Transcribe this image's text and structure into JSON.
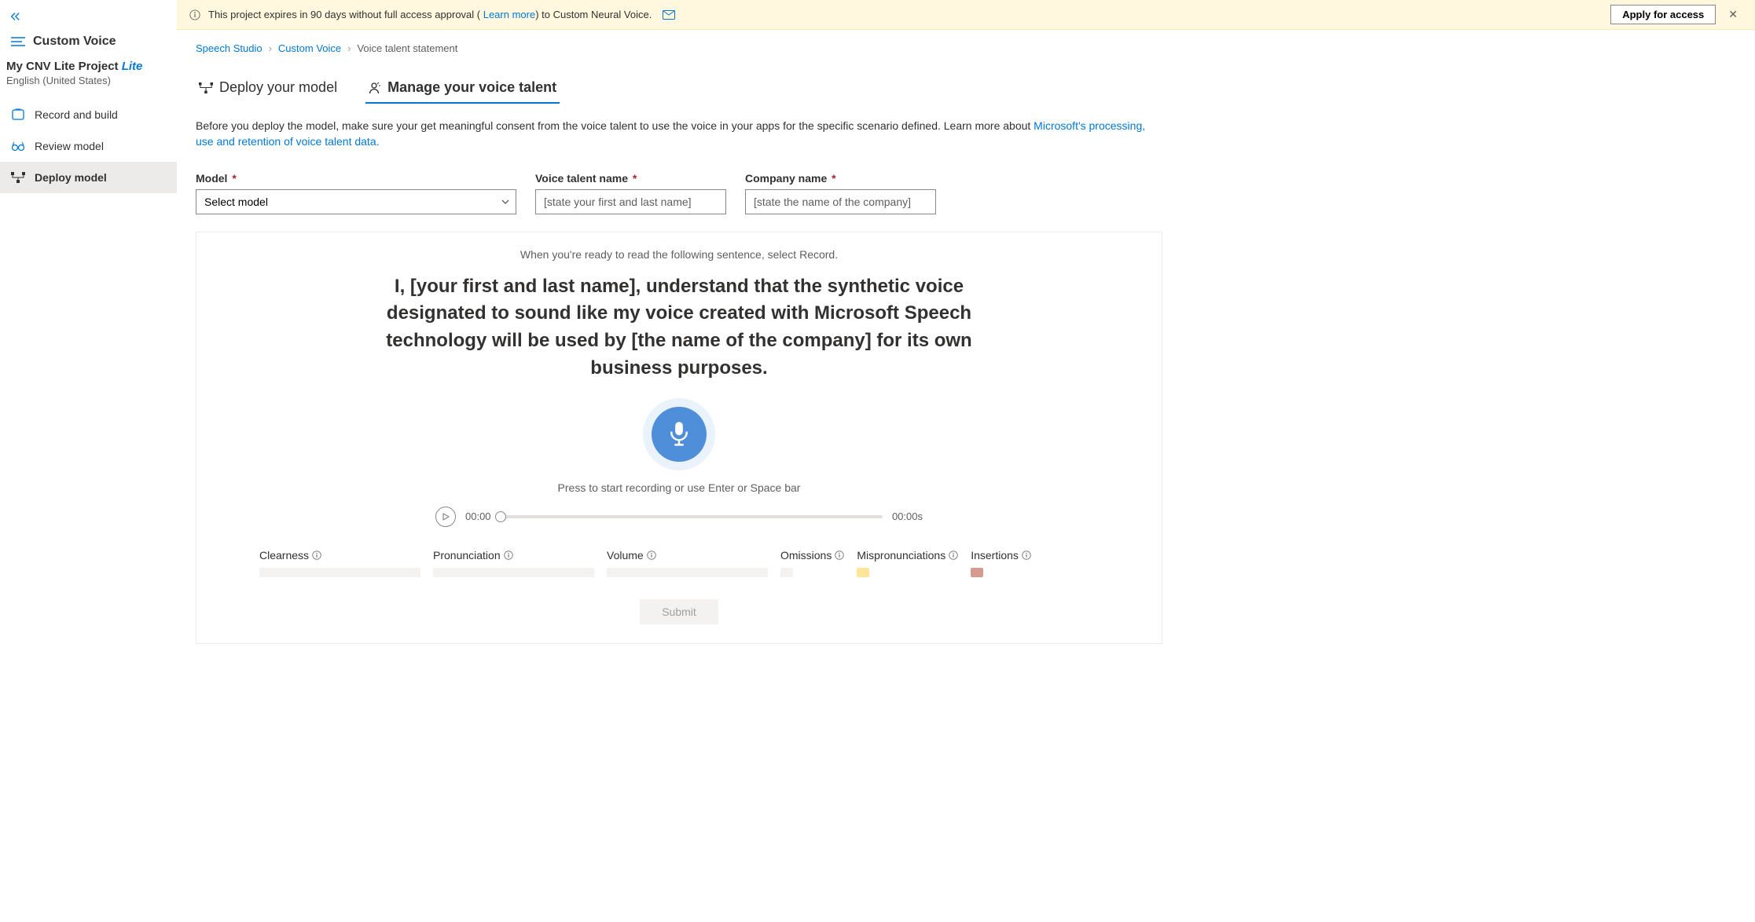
{
  "sidebar": {
    "title": "Custom Voice",
    "project": {
      "name": "My CNV Lite Project",
      "badge": "Lite",
      "sub": "English (United States)"
    },
    "nav": [
      {
        "label": "Record and build"
      },
      {
        "label": "Review model"
      },
      {
        "label": "Deploy model"
      }
    ]
  },
  "banner": {
    "text_before": "This project expires in 90 days without full access approval (",
    "learn_link": " Learn more",
    "text_after": ") to Custom Neural Voice.",
    "apply": "Apply for access"
  },
  "breadcrumb": {
    "a": "Speech Studio",
    "b": "Custom Voice",
    "c": "Voice talent statement"
  },
  "tabs": {
    "deploy": "Deploy your model",
    "manage": "Manage your voice talent"
  },
  "intro": {
    "text": "Before you deploy the model, make sure your get meaningful consent from the voice talent to use the voice in your apps for the specific scenario defined. Learn more about ",
    "link": "Microsoft's processing, use and retention of voice talent data."
  },
  "fields": {
    "model_label": "Model",
    "model_placeholder": "Select model",
    "talent_label": "Voice talent name",
    "talent_placeholder": "[state your first and last name]",
    "company_label": "Company name",
    "company_placeholder": "[state the name of the company]"
  },
  "panel": {
    "ready": "When you're ready to read the following sentence, select Record.",
    "statement": "I, [your first and last name], understand that the synthetic voice designated to sound like my voice created with Microsoft Speech technology will be used by [the name of the company] for its own business purposes.",
    "press": "Press to start recording or use Enter or Space bar",
    "time_cur": "00:00",
    "time_total": "00:00s",
    "metrics": {
      "clear": "Clearness",
      "pron": "Pronunciation",
      "vol": "Volume",
      "omit": "Omissions",
      "mispron": "Mispronunciations",
      "ins": "Insertions"
    },
    "submit": "Submit"
  }
}
